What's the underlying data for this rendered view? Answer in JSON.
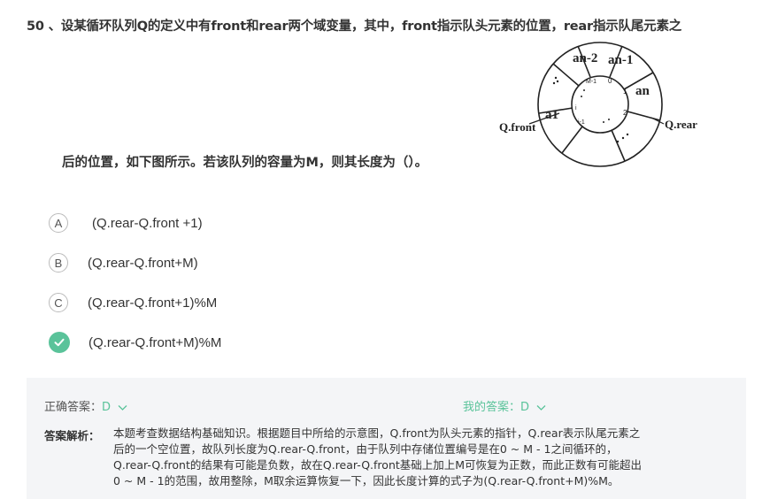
{
  "question": {
    "line1": "50 、设某循环队列Q的定义中有front和rear两个域变量，其中，front指示队头元素的位置，rear指示队尾元素之",
    "line2": "后的位置，如下图所示。若该队列的容量为M，则其长度为（）。"
  },
  "diagram": {
    "label_front": "Q.front",
    "label_rear": "Q.rear",
    "cell_an2": "an-2",
    "cell_an1": "an-1",
    "cell_an": "an",
    "cell_a1": "a1",
    "idx_m1": "M-1",
    "idx_0": "0",
    "idx_1": "1",
    "idx_2": "2",
    "idx_i1": "i-1",
    "idx_i": "i"
  },
  "options": [
    {
      "letter": "A",
      "text": "(Q.rear-Q.front +1)"
    },
    {
      "letter": "B",
      "text": "(Q.rear-Q.front+M)"
    },
    {
      "letter": "C",
      "text": "(Q.rear-Q.front+1)%M"
    },
    {
      "letter": "D",
      "text": "(Q.rear-Q.front+M)%M",
      "selected": true
    }
  ],
  "answer": {
    "correct_label": "正确答案：",
    "correct_value": "D",
    "my_label": "我的答案：",
    "my_value": "D",
    "analysis_label": "答案解析：",
    "analysis_lines": [
      "本题考查数据结构基础知识。根据题目中所给的示意图，Q.front为队头元素的指针，Q.rear表示队尾元素之",
      "后的一个空位置，故队列长度为Q.rear-Q.front，由于队列中存储位置编号是在0 ~ M - 1之间循环的，",
      "Q.rear-Q.front的结果有可能是负数，故在Q.rear-Q.front基础上加上M可恢复为正数，而此正数有可能超出",
      "0 ~ M - 1的范围，故用整除，M取余运算恢复一下，因此长度计算的式子为(Q.rear-Q.front+M)%M。"
    ]
  },
  "colors": {
    "accent_green": "#5ac39a",
    "panel_bg": "#f4f5f7"
  }
}
